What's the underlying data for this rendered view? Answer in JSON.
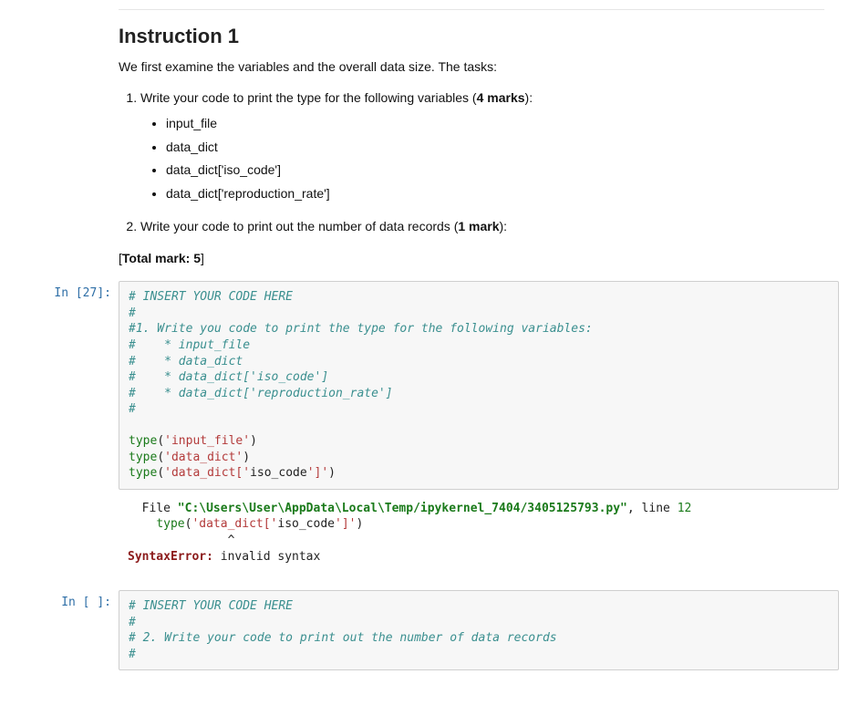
{
  "markdown": {
    "heading": "Instruction 1",
    "intro": "We first examine the variables and the overall data size. The tasks:",
    "task1_prefix": "Write your code to print the type for the following variables (",
    "task1_bold": "4 marks",
    "task1_suffix": "):",
    "vars": [
      "input_file",
      "data_dict",
      "data_dict['iso_code']",
      "data_dict['reproduction_rate']"
    ],
    "task2_prefix": "Write your code to print out the number of data records (",
    "task2_bold": "1 mark",
    "task2_suffix": "):",
    "total_open": "[",
    "total_bold": "Total mark: 5",
    "total_close": "]"
  },
  "cell1": {
    "prompt": "In [27]:",
    "lines": {
      "c1": "# INSERT YOUR CODE HERE",
      "c2": "#",
      "c3": "#1. Write you code to print the type for the following variables:",
      "c4": "#    * input_file",
      "c5": "#    * data_dict",
      "c6": "#    * data_dict['iso_code']",
      "c7": "#    * data_dict['reproduction_rate']",
      "c8": "#",
      "t1_fn": "type",
      "t1_op": "(",
      "t1_str": "'input_file'",
      "t1_cl": ")",
      "t2_fn": "type",
      "t2_op": "(",
      "t2_str": "'data_dict'",
      "t2_cl": ")",
      "t3_fn": "type",
      "t3_op": "(",
      "t3_s1": "'data_dict['",
      "t3_mid": "iso_code",
      "t3_s2": "']'",
      "t3_cl": ")"
    }
  },
  "output": {
    "file_label": "  File ",
    "file_path": "\"C:\\Users\\User\\AppData\\Local\\Temp/ipykernel_7404/3405125793.py\"",
    "file_tail": ", line ",
    "file_lineno": "12",
    "code_indent": "    ",
    "code_fn": "type",
    "code_op": "(",
    "code_s1": "'data_dict['",
    "code_mid": "iso_code",
    "code_s2": "']'",
    "code_cl": ")",
    "caret": "              ^",
    "err_name": "SyntaxError:",
    "err_msg": " invalid syntax"
  },
  "cell2": {
    "prompt": "In [ ]:",
    "lines": {
      "c1": "# INSERT YOUR CODE HERE",
      "c2": "#",
      "c3": "# 2. Write your code to print out the number of data records",
      "c4": "#"
    }
  }
}
